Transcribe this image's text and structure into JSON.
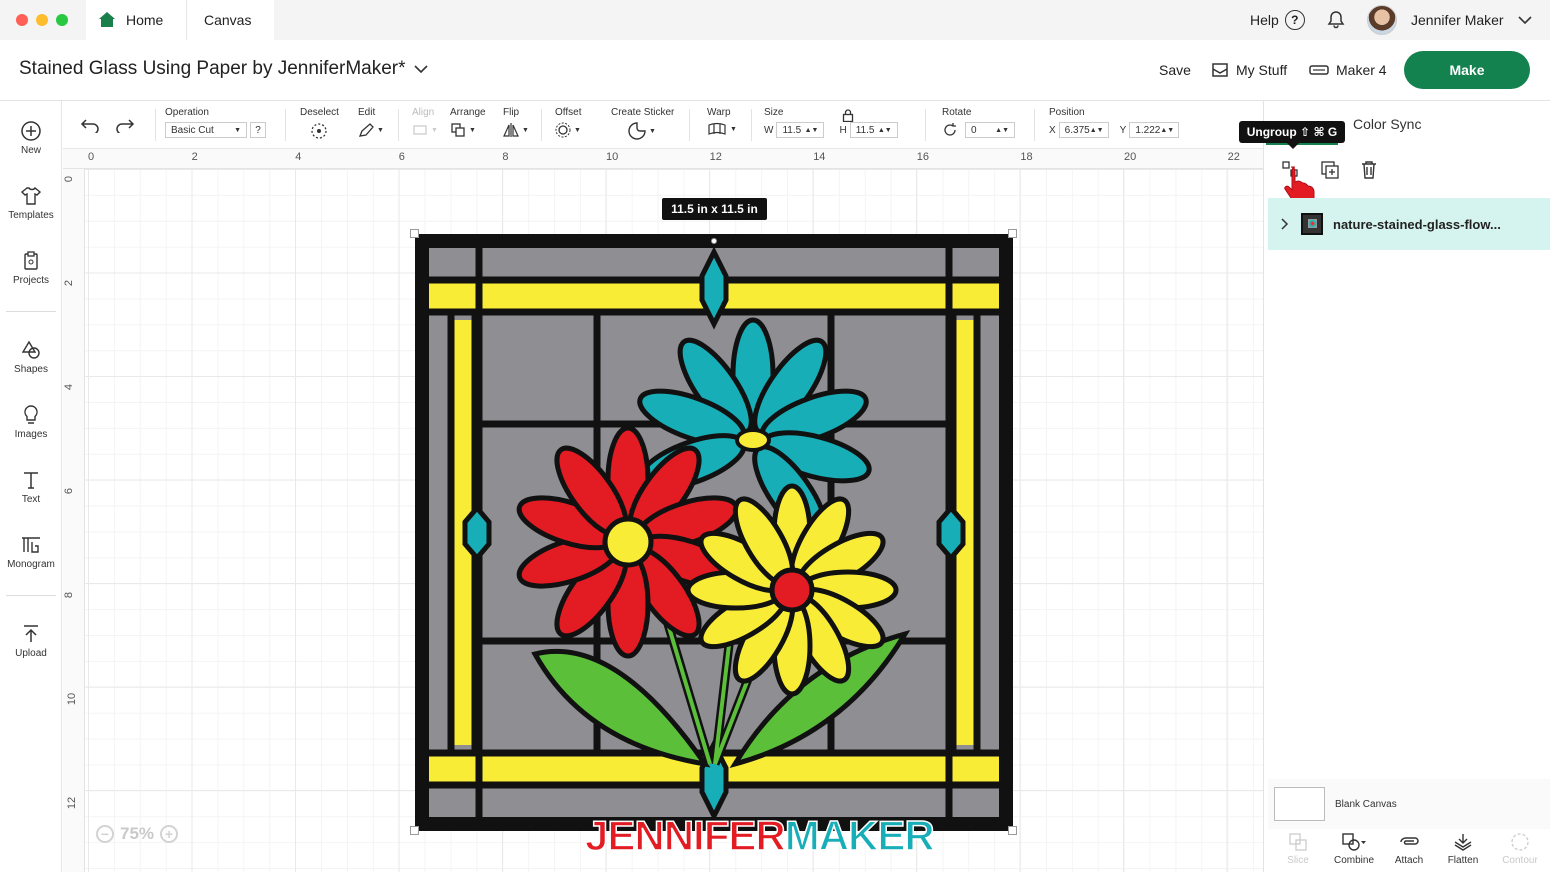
{
  "tabs": {
    "home": "Home",
    "canvas": "Canvas"
  },
  "topbar": {
    "help": "Help",
    "user_name": "Jennifer Maker"
  },
  "header": {
    "project_title": "Stained Glass Using Paper by JenniferMaker*",
    "save": "Save",
    "my_stuff": "My Stuff",
    "machine": "Maker 4",
    "make": "Make"
  },
  "sidebar": {
    "items": [
      {
        "label": "New",
        "icon": "plus-circle-icon"
      },
      {
        "label": "Templates",
        "icon": "shirt-icon"
      },
      {
        "label": "Projects",
        "icon": "clipboard-icon"
      },
      {
        "label": "Shapes",
        "icon": "shapes-icon"
      },
      {
        "label": "Images",
        "icon": "lightbulb-icon"
      },
      {
        "label": "Text",
        "icon": "text-icon"
      },
      {
        "label": "Monogram",
        "icon": "monogram-icon"
      },
      {
        "label": "Upload",
        "icon": "upload-icon"
      }
    ]
  },
  "toolbar": {
    "operation_label": "Operation",
    "operation_value": "Basic Cut",
    "operation_help": "?",
    "deselect": "Deselect",
    "edit": "Edit",
    "align": "Align",
    "arrange": "Arrange",
    "flip": "Flip",
    "offset": "Offset",
    "create_sticker": "Create Sticker",
    "warp": "Warp",
    "size": "Size",
    "w_label": "W",
    "w_value": "11.5",
    "h_label": "H",
    "h_value": "11.5",
    "rotate": "Rotate",
    "rotate_value": "0",
    "position": "Position",
    "x_label": "X",
    "x_value": "6.375",
    "y_label": "Y",
    "y_value": "1.222"
  },
  "ruler": {
    "top": [
      "0",
      "2",
      "4",
      "6",
      "8",
      "10",
      "12",
      "14",
      "16",
      "18",
      "20",
      "22"
    ],
    "left": [
      "0",
      "2",
      "4",
      "6",
      "8",
      "10",
      "12"
    ]
  },
  "canvas": {
    "size_tag": "11.5  in x 11.5  in",
    "zoom": "75%",
    "watermark_a": "JENNIFER",
    "watermark_b": "MAKER",
    "colors": {
      "frame": "#111111",
      "yellow": "#f9ec36",
      "gray": "#8e8e93",
      "teal": "#17aeb8",
      "red": "#e31b23",
      "green": "#5cbf3a"
    }
  },
  "panel": {
    "tooltip": "Ungroup ⇧ ⌘ G",
    "color_sync": "Color Sync",
    "layer_name": "nature-stained-glass-flow...",
    "blank_canvas": "Blank Canvas",
    "bottom_tools": [
      {
        "label": "Slice",
        "enabled": false
      },
      {
        "label": "Combine",
        "enabled": true
      },
      {
        "label": "Attach",
        "enabled": true
      },
      {
        "label": "Flatten",
        "enabled": true
      },
      {
        "label": "Contour",
        "enabled": false
      }
    ]
  }
}
